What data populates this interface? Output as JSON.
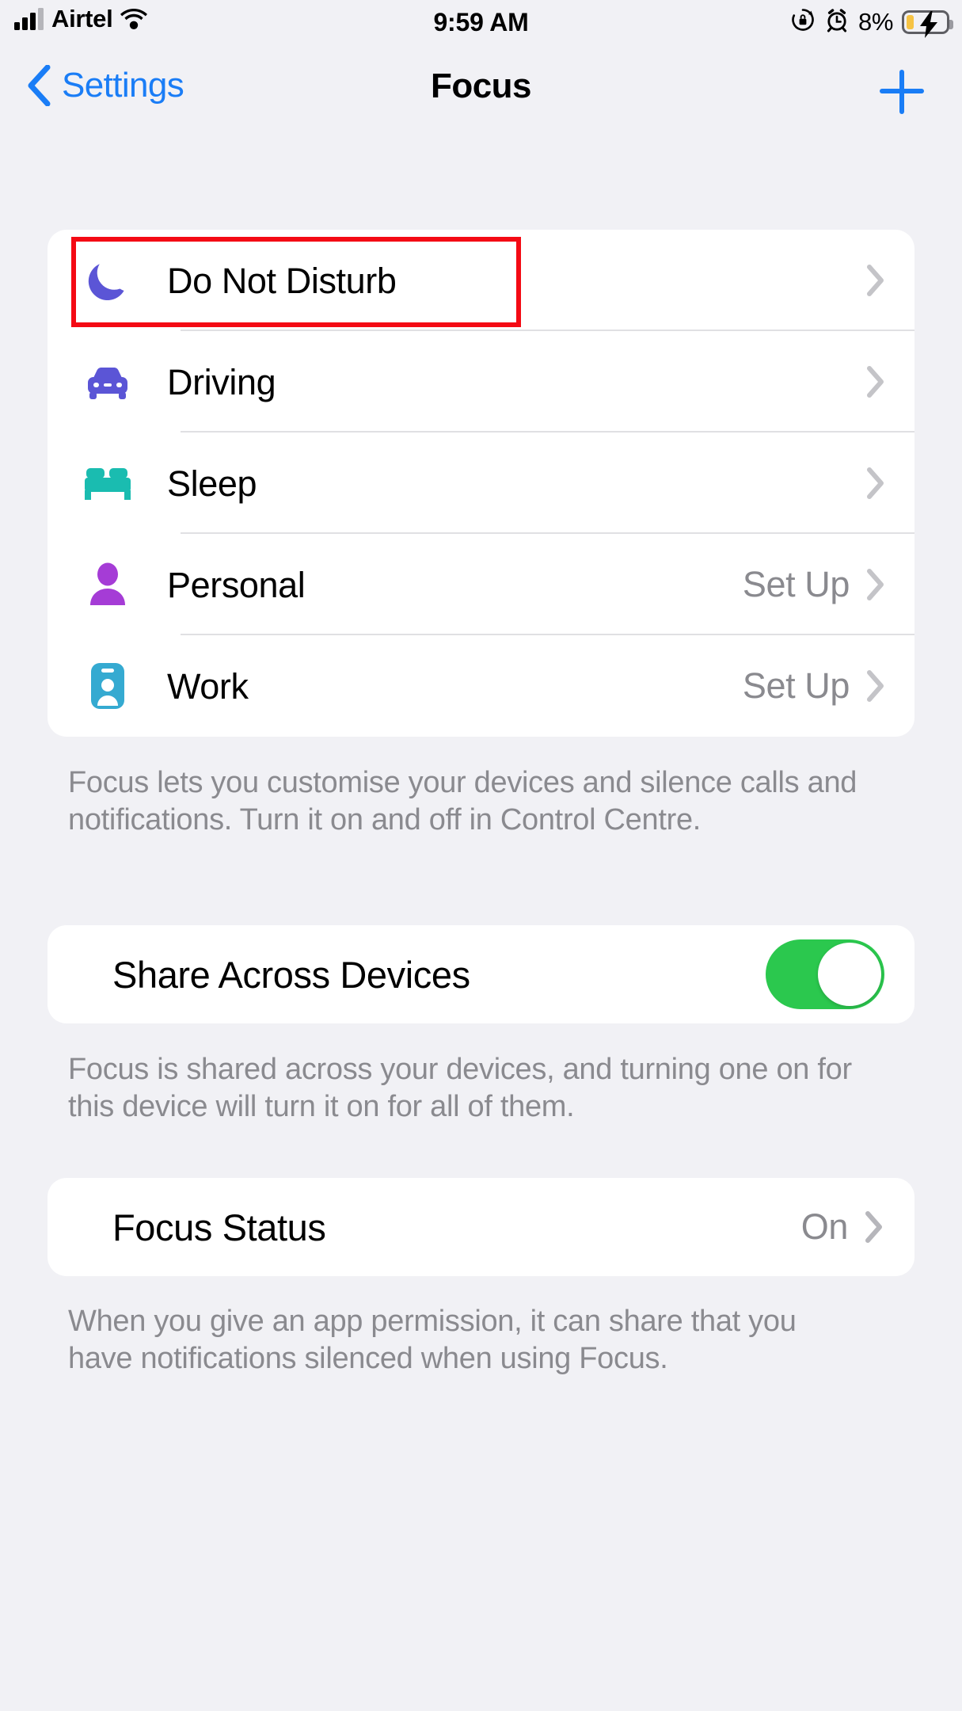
{
  "status_bar": {
    "carrier": "Airtel",
    "time": "9:59 AM",
    "battery_percent": "8%",
    "icons": [
      "signal-icon",
      "wifi-icon",
      "rotation-lock-icon",
      "alarm-icon",
      "battery-charging-icon"
    ]
  },
  "nav": {
    "back_label": "Settings",
    "title": "Focus",
    "add_label": "+"
  },
  "focus_list": {
    "items": [
      {
        "label": "Do Not Disturb",
        "icon": "moon-icon",
        "color": "#5B55D6",
        "value": "",
        "highlighted": true
      },
      {
        "label": "Driving",
        "icon": "car-icon",
        "color": "#5B55D6",
        "value": "",
        "highlighted": false
      },
      {
        "label": "Sleep",
        "icon": "bed-icon",
        "color": "#1ABCB0",
        "value": "",
        "highlighted": false
      },
      {
        "label": "Personal",
        "icon": "person-icon",
        "color": "#A53CD6",
        "value": "Set Up",
        "highlighted": false
      },
      {
        "label": "Work",
        "icon": "badge-icon",
        "color": "#35AAD1",
        "value": "Set Up",
        "highlighted": false
      }
    ],
    "footer": "Focus lets you customise your devices and silence calls and notifications. Turn it on and off in Control Centre."
  },
  "share_section": {
    "label": "Share Across Devices",
    "toggle_state": "on",
    "toggle_color": "#2BC84E",
    "footer": "Focus is shared across your devices, and turning one on for this device will turn it on for all of them."
  },
  "status_section": {
    "label": "Focus Status",
    "value": "On",
    "footer": "When you give an app permission, it can share that you have notifications silenced when using Focus."
  },
  "theme": {
    "background": "#F1F1F5",
    "card": "#FFFFFF",
    "accent": "#1A7DF6",
    "secondary_text": "#8A8A8F",
    "annotation": "#F40A14"
  }
}
